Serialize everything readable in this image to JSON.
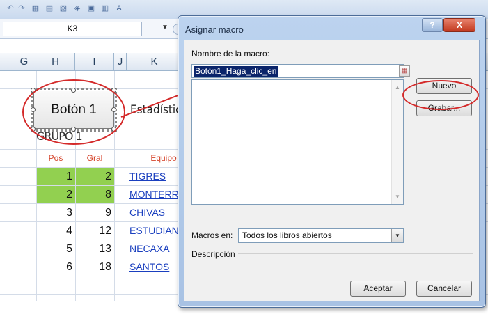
{
  "excel": {
    "name_box": "K3",
    "columns": [
      "G",
      "H",
      "I",
      "J",
      "K"
    ],
    "form_button_label": "Botón 1",
    "title_text": "Estadística",
    "group_label": "GRUPO 1",
    "table_headers": {
      "pos": "Pos",
      "gral": "Gral",
      "team": "Equipo"
    },
    "rows": [
      {
        "pos": "1",
        "gral": "2",
        "team": "TIGRES"
      },
      {
        "pos": "2",
        "gral": "8",
        "team": "MONTERREY"
      },
      {
        "pos": "3",
        "gral": "9",
        "team": "CHIVAS"
      },
      {
        "pos": "4",
        "gral": "12",
        "team": "ESTUDIANTES"
      },
      {
        "pos": "5",
        "gral": "13",
        "team": "NECAXA"
      },
      {
        "pos": "6",
        "gral": "18",
        "team": "SANTOS"
      }
    ],
    "highlight_color": "#92d050"
  },
  "dialog": {
    "title": "Asignar macro",
    "help_glyph": "?",
    "close_glyph": "X",
    "macro_name_label": "Nombre de la macro:",
    "macro_name_value": "Botón1_Haga_clic_en",
    "buttons": {
      "new": "Nuevo",
      "record": "Grabar...",
      "ok": "Aceptar",
      "cancel": "Cancelar"
    },
    "macros_in_label": "Macros en:",
    "macros_in_value": "Todos los libros abiertos",
    "description_label": "Descripción"
  },
  "annotation_color": "#d42a2a"
}
